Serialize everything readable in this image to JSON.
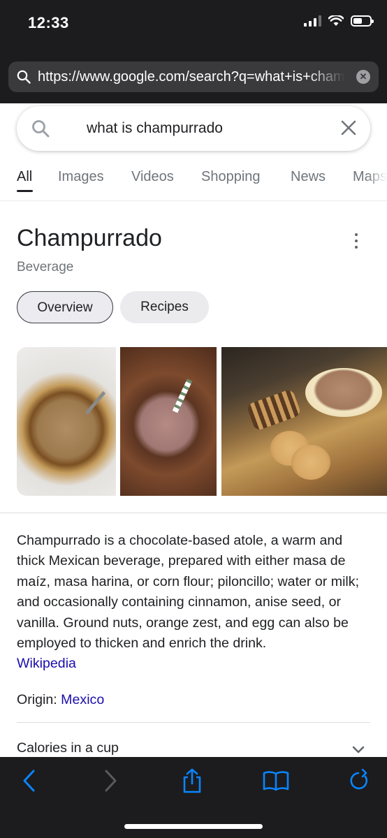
{
  "status_bar": {
    "time": "12:33"
  },
  "browser": {
    "url": "https://www.google.com/search?q=what+is+champurrado"
  },
  "search": {
    "query": "what is champurrado"
  },
  "tabs": [
    {
      "label": "All"
    },
    {
      "label": "Images"
    },
    {
      "label": "Videos"
    },
    {
      "label": "Shopping"
    },
    {
      "label": "News"
    },
    {
      "label": "Maps"
    }
  ],
  "knowledge_panel": {
    "title": "Champurrado",
    "subtitle": "Beverage",
    "chips": [
      {
        "label": "Overview"
      },
      {
        "label": "Recipes"
      }
    ],
    "description": "Champurrado is a chocolate-based atole, a warm and thick Mexican beverage, prepared with either masa de maíz, masa harina, or corn flour; piloncillo; water or milk; and occasionally containing cinnamon, anise seed, or vanilla. Ground nuts, orange zest, and egg can also be employed to thicken and enrich the drink.",
    "source_link": "Wikipedia",
    "origin_label": "Origin:",
    "origin_value": "Mexico",
    "calories_label": "Calories in a cup"
  },
  "colors": {
    "link": "#1a0dab",
    "ios_accent": "#0a84ff",
    "chrome_dark": "#1c1c1e"
  },
  "toolbar_icons": [
    "back-icon",
    "forward-icon",
    "share-icon",
    "bookmarks-icon",
    "tabs-icon"
  ]
}
